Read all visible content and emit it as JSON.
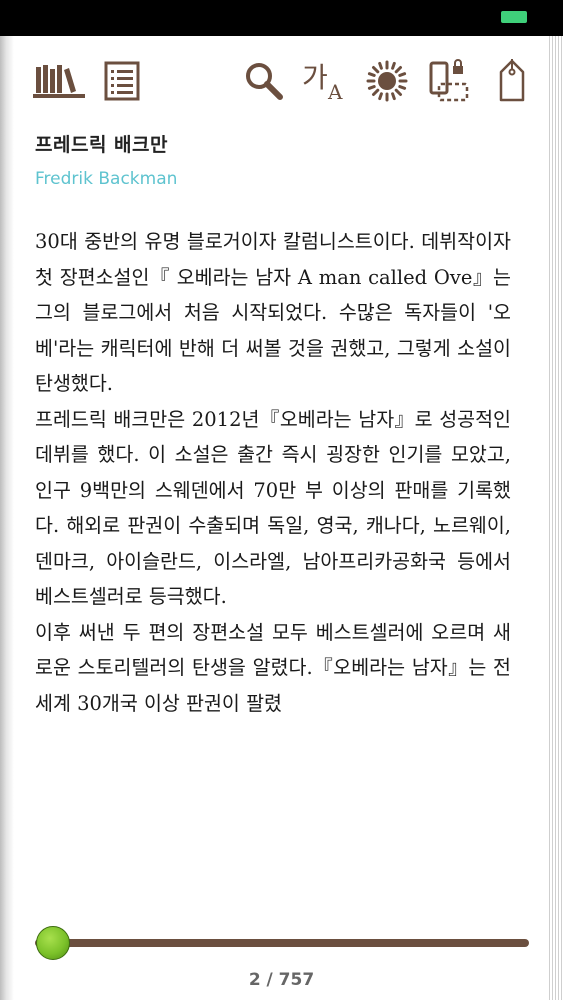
{
  "colors": {
    "icon_brown": "#6b4f3f",
    "author_en": "#5ec3cf",
    "slider_thumb": "#7cc22a",
    "battery": "#3fd07a"
  },
  "toolbar": {
    "icons": [
      "library-icon",
      "toc-icon",
      "search-icon",
      "font-size-icon",
      "brightness-icon",
      "orientation-lock-icon",
      "bookmark-icon"
    ],
    "font_glyph_big": "가",
    "font_glyph_small": "A"
  },
  "author": {
    "name_ko": "프레드릭 배크만",
    "name_en": "Fredrik Backman"
  },
  "content": {
    "paragraphs": [
      "30대 중반의 유명 블로거이자 칼럼니스트이다. 데뷔작이자 첫 장편소설인『 오베라는 남자 A man called Ove』는 그의 블로그에서 처음 시작되었다. 수많은 독자들이 '오베'라는 캐릭터에 반해 더 써볼 것을 권했고, 그렇게 소설이 탄생했다.",
      "프레드릭 배크만은 2012년『오베라는 남자』로 성공적인 데뷔를 했다. 이 소설은 출간 즉시 굉장한 인기를 모았고, 인구 9백만의 스웨덴에서 70만 부 이상의 판매를 기록했다. 해외로 판권이 수출되며 독일, 영국, 캐나다, 노르웨이, 덴마크, 아이슬란드, 이스라엘, 남아프리카공화국 등에서 베스트셀러로 등극했다.",
      "이후 써낸 두 편의 장편소설 모두 베스트셀러에 오르며 새로운 스토리텔러의 탄생을 알렸다.『오베라는 남자』는 전 세계 30개국 이상 판권이 팔렸"
    ]
  },
  "progress": {
    "current_page": 2,
    "total_pages": 757,
    "fraction": 0.0026,
    "label": "2 / 757"
  }
}
